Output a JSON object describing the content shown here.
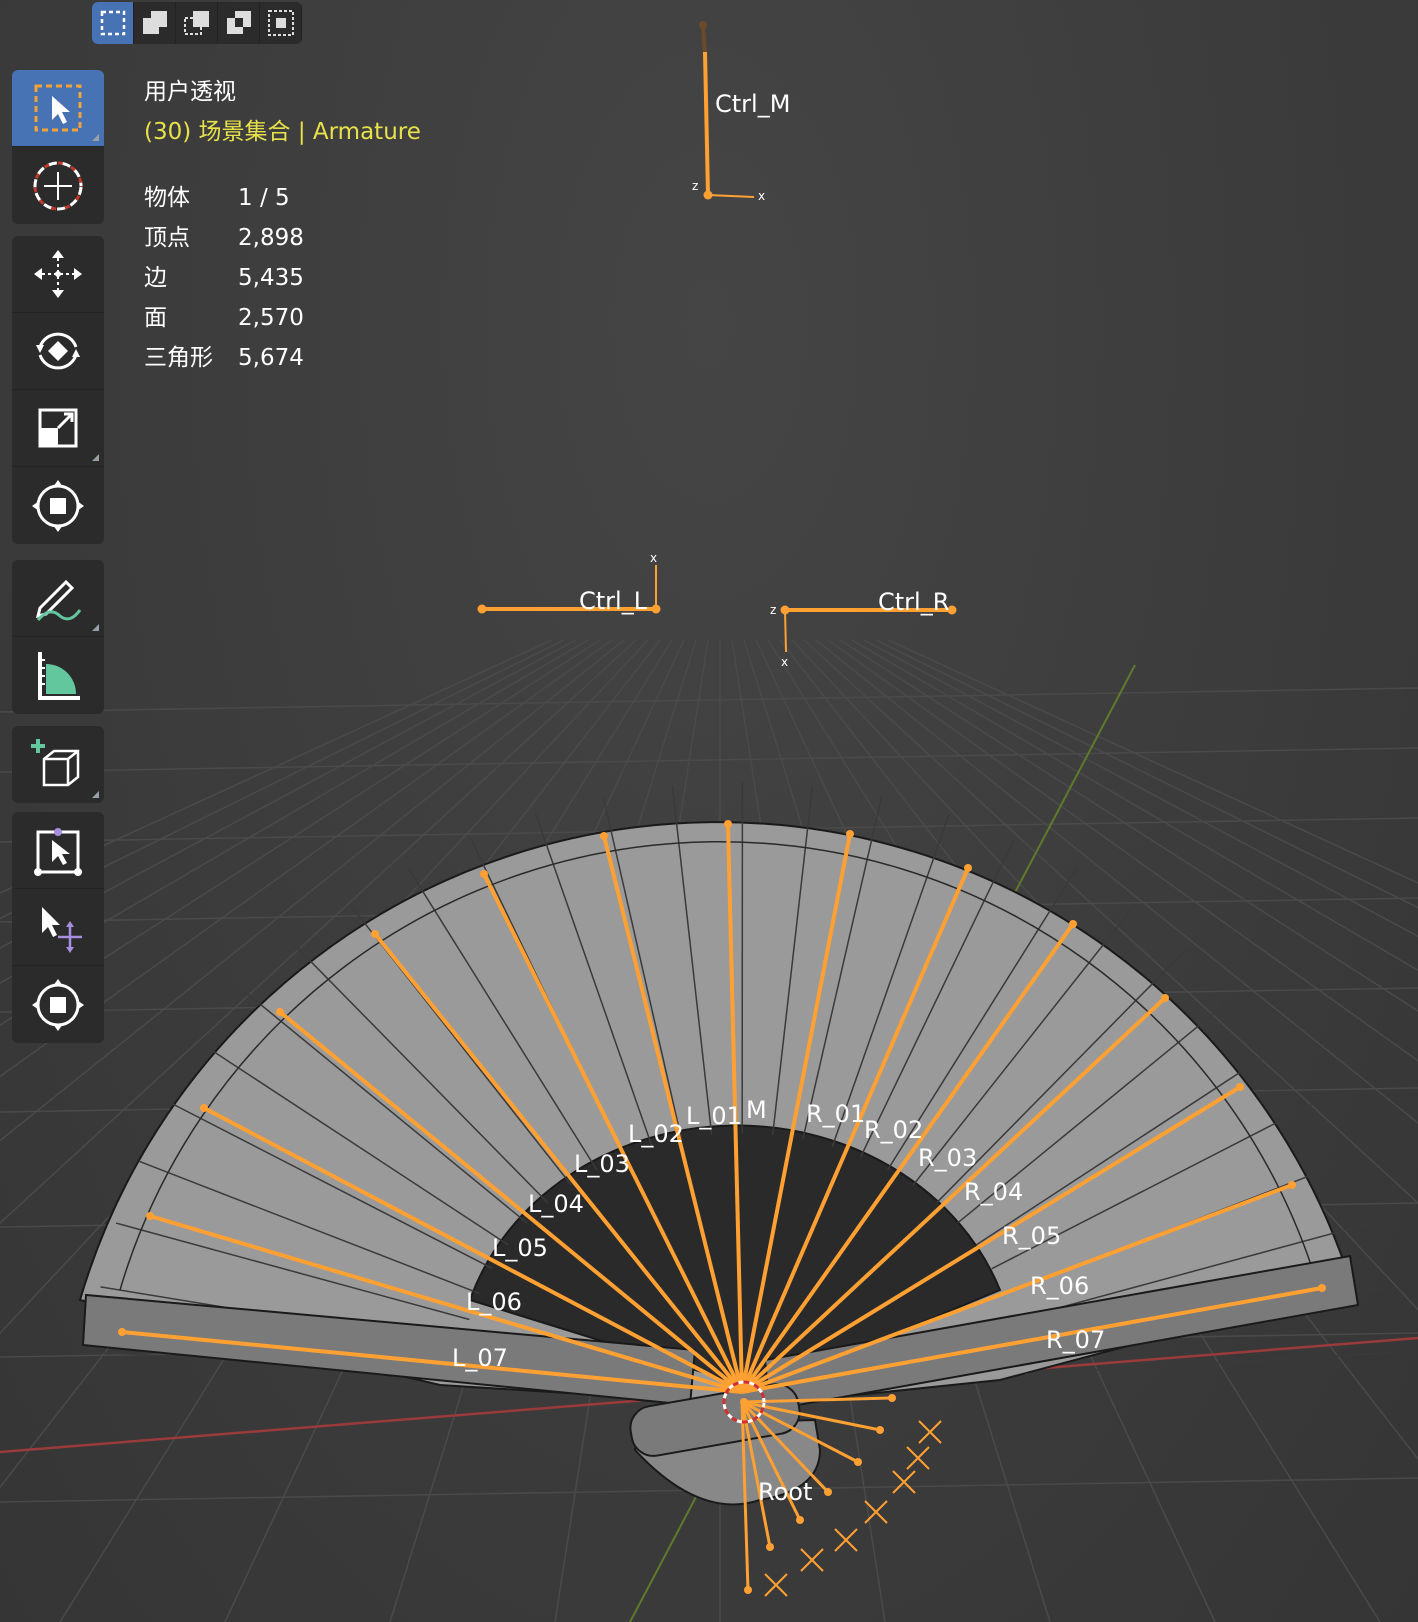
{
  "viewport": {
    "view_name": "用户透视",
    "collection_info": "(30) 场景集合 | Armature",
    "stats": [
      {
        "label": "物体",
        "value": "1 / 5"
      },
      {
        "label": "顶点",
        "value": "2,898"
      },
      {
        "label": "边",
        "value": "5,435"
      },
      {
        "label": "面",
        "value": "2,570"
      },
      {
        "label": "三角形",
        "value": "5,674"
      }
    ]
  },
  "select_modes": [
    {
      "icon": "select-new-icon",
      "active": true
    },
    {
      "icon": "select-extend-icon",
      "active": false
    },
    {
      "icon": "select-subtract-icon",
      "active": false
    },
    {
      "icon": "select-invert-icon",
      "active": false
    },
    {
      "icon": "select-intersect-icon",
      "active": false
    }
  ],
  "toolbar": [
    {
      "group": 1,
      "tools": [
        "select-box-icon",
        "cursor-icon"
      ]
    },
    {
      "group": 2,
      "tools": [
        "move-icon",
        "rotate-icon",
        "scale-icon",
        "transform-icon"
      ]
    },
    {
      "group": 3,
      "tools": [
        "annotate-icon",
        "measure-icon"
      ]
    },
    {
      "group": 4,
      "tools": [
        "add-cube-icon"
      ]
    },
    {
      "group": 5,
      "tools": [
        "edit-pose-icon",
        "move-pose-icon",
        "transform-pose-icon"
      ]
    }
  ],
  "bones": {
    "controls": [
      "Ctrl_M",
      "Ctrl_L",
      "Ctrl_R"
    ],
    "center": "M",
    "left": [
      "L_01",
      "L_02",
      "L_03",
      "L_04",
      "L_05",
      "L_06",
      "L_07"
    ],
    "right": [
      "R_01",
      "R_02",
      "R_03",
      "R_04",
      "R_05",
      "R_06",
      "R_07"
    ],
    "root": "Root"
  },
  "axis_letters": {
    "x": "x",
    "z": "z"
  },
  "colors": {
    "bone": "#ffa033",
    "fan_surface": "#9a9a9a",
    "active_tool": "#4772b3",
    "collection_text": "#e8e24a",
    "x_axis": "#9b3a3a",
    "y_axis": "#5e7b2c"
  }
}
